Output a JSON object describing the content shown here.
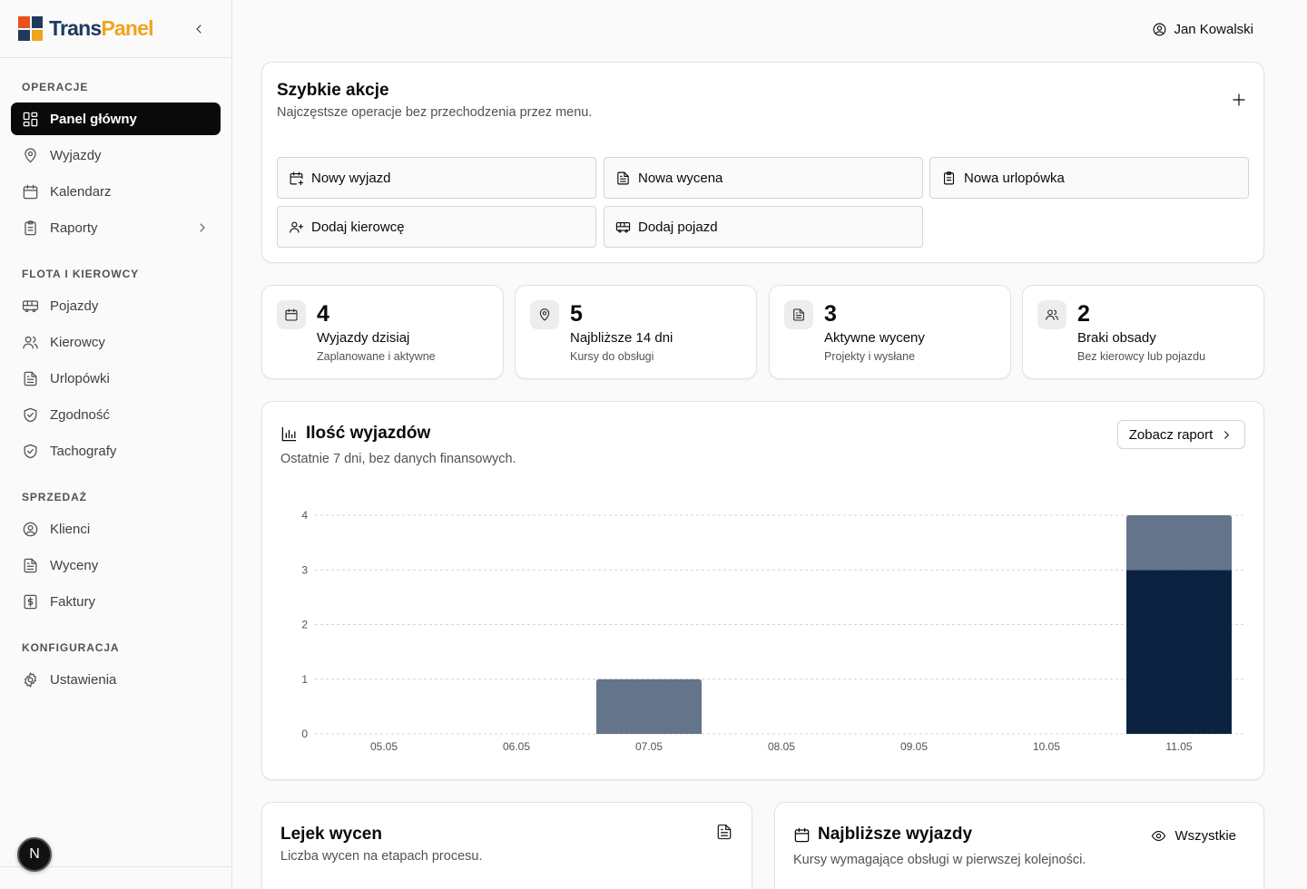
{
  "brand": {
    "name_part1": "Trans",
    "name_part2": "Panel",
    "logo_colors": [
      "#e8521c",
      "#1e3a5f",
      "#1e3a5f",
      "#f2a31b"
    ]
  },
  "header": {
    "user_name": "Jan Kowalski"
  },
  "sidebar": {
    "sections": [
      {
        "title": "OPERACJE",
        "items": [
          {
            "label": "Panel główny",
            "icon": "dashboard-icon",
            "active": true
          },
          {
            "label": "Wyjazdy",
            "icon": "map-pin-icon"
          },
          {
            "label": "Kalendarz",
            "icon": "calendar-icon"
          },
          {
            "label": "Raporty",
            "icon": "clipboard-icon",
            "has_submenu": true
          }
        ]
      },
      {
        "title": "FLOTA I KIEROWCY",
        "items": [
          {
            "label": "Pojazdy",
            "icon": "bus-icon"
          },
          {
            "label": "Kierowcy",
            "icon": "users-icon"
          },
          {
            "label": "Urlopówki",
            "icon": "file-text-icon"
          },
          {
            "label": "Zgodność",
            "icon": "shield-check-icon"
          },
          {
            "label": "Tachografy",
            "icon": "shield-check-icon"
          }
        ]
      },
      {
        "title": "SPRZEDAŻ",
        "items": [
          {
            "label": "Klienci",
            "icon": "user-circle-icon"
          },
          {
            "label": "Wyceny",
            "icon": "file-text-icon"
          },
          {
            "label": "Faktury",
            "icon": "invoice-dollar-icon"
          }
        ]
      },
      {
        "title": "KONFIGURACJA",
        "items": [
          {
            "label": "Ustawienia",
            "icon": "gear-icon"
          }
        ]
      }
    ],
    "bottom_badge": "N"
  },
  "quick_actions": {
    "title": "Szybkie akcje",
    "subtitle": "Najczęstsze operacje bez przechodzenia przez menu.",
    "buttons": [
      {
        "label": "Nowy wyjazd",
        "icon": "calendar-plus-icon"
      },
      {
        "label": "Nowa wycena",
        "icon": "file-text-icon"
      },
      {
        "label": "Nowa urlopówka",
        "icon": "clipboard-icon"
      },
      {
        "label": "Dodaj kierowcę",
        "icon": "user-plus-icon"
      },
      {
        "label": "Dodaj pojazd",
        "icon": "bus-icon"
      }
    ]
  },
  "stats": [
    {
      "value": "4",
      "label": "Wyjazdy dzisiaj",
      "desc": "Zaplanowane i aktywne",
      "icon": "calendar-icon"
    },
    {
      "value": "5",
      "label": "Najbliższe 14 dni",
      "desc": "Kursy do obsługi",
      "icon": "map-pin-icon"
    },
    {
      "value": "3",
      "label": "Aktywne wyceny",
      "desc": "Projekty i wysłane",
      "icon": "file-text-icon"
    },
    {
      "value": "2",
      "label": "Braki obsady",
      "desc": "Bez kierowcy lub pojazdu",
      "icon": "users-icon"
    }
  ],
  "trips_chart": {
    "title": "Ilość wyjazdów",
    "subtitle": "Ostatnie 7 dni, bez danych finansowych.",
    "report_button": "Zobacz raport"
  },
  "chart_data": {
    "type": "bar",
    "stacked": true,
    "categories": [
      "05.05",
      "06.05",
      "07.05",
      "08.05",
      "09.05",
      "10.05",
      "11.05"
    ],
    "series": [
      {
        "values": [
          0,
          0,
          0,
          0,
          0,
          0,
          3
        ],
        "color": "#0b2341"
      },
      {
        "values": [
          0,
          0,
          1,
          0,
          0,
          0,
          1
        ],
        "color": "#64748b"
      }
    ],
    "ylim": [
      0,
      4
    ],
    "yticks": [
      0,
      1,
      2,
      3,
      4
    ],
    "grid": true,
    "title": "",
    "xlabel": "",
    "ylabel": ""
  },
  "funnel": {
    "title": "Lejek wycen",
    "subtitle": "Liczba wycen na etapach procesu."
  },
  "upcoming": {
    "title": "Najbliższe wyjazdy",
    "subtitle": "Kursy wymagające obsługi w pierwszej kolejności.",
    "all_button": "Wszystkie"
  }
}
